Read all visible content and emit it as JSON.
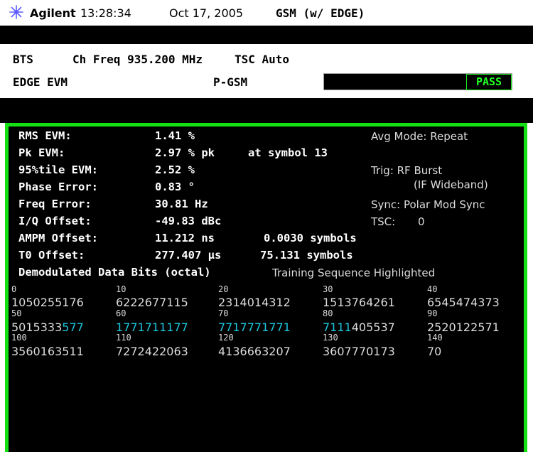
{
  "header": {
    "brand": "Agilent",
    "time": "13:28:34",
    "date": "Oct 17, 2005",
    "mode": "GSM (w/ EDGE)"
  },
  "instrument": {
    "device": "BTS",
    "ch_freq": "Ch Freq 935.200 MHz",
    "tsc": "TSC Auto",
    "measurement": "EDGE EVM",
    "band": "P-GSM",
    "status": "PASS"
  },
  "results": [
    {
      "label": "RMS EVM:",
      "value": "1.41 %",
      "extra": ""
    },
    {
      "label": "Pk EVM:",
      "value": "2.97 % pk",
      "extra": "at symbol 13"
    },
    {
      "label": "95%tile EVM:",
      "value": "2.52 %",
      "extra": ""
    },
    {
      "label": "Phase Error:",
      "value": "0.83 °",
      "extra": ""
    },
    {
      "label": "Freq Error:",
      "value": "30.81 Hz",
      "extra": ""
    },
    {
      "label": "I/Q Offset:",
      "value": "-49.83 dBc",
      "extra": ""
    },
    {
      "label": "AMPM Offset:",
      "value": "11.212 ns",
      "extra": "0.0030 symbols"
    },
    {
      "label": "T0 Offset:",
      "value": "277.407 μs",
      "extra": "75.131 symbols"
    }
  ],
  "right_info": {
    "avg_mode": "Avg Mode: Repeat",
    "trig_1": "Trig: RF Burst",
    "trig_2": "(IF Wideband)",
    "sync": "Sync: Polar Mod Sync",
    "tsc_label": "TSC:",
    "tsc_value": "0"
  },
  "demod": {
    "title": "Demodulated Data Bits (octal)",
    "note": "Training Sequence Highlighted",
    "rows": [
      {
        "idx": [
          "0",
          "10",
          "20",
          "30",
          "40"
        ],
        "groups": [
          [
            "1050255176",
            ""
          ],
          [
            "6222677115",
            ""
          ],
          [
            "2314014312",
            ""
          ],
          [
            "1513764261",
            ""
          ],
          [
            "6545474373",
            ""
          ]
        ]
      },
      {
        "idx": [
          "50",
          "60",
          "70",
          "80",
          "90"
        ],
        "groups": [
          [
            "5015333",
            "577"
          ],
          [
            "",
            "1771711177"
          ],
          [
            "",
            "7717771771"
          ],
          [
            "7111",
            "405537"
          ],
          [
            "2520122571",
            ""
          ]
        ]
      },
      {
        "idx": [
          "100",
          "110",
          "120",
          "130",
          "140"
        ],
        "groups": [
          [
            "3560163511",
            ""
          ],
          [
            "7272422063",
            ""
          ],
          [
            "4136663207",
            ""
          ],
          [
            "3607770173",
            ""
          ],
          [
            "70",
            ""
          ]
        ]
      }
    ]
  }
}
